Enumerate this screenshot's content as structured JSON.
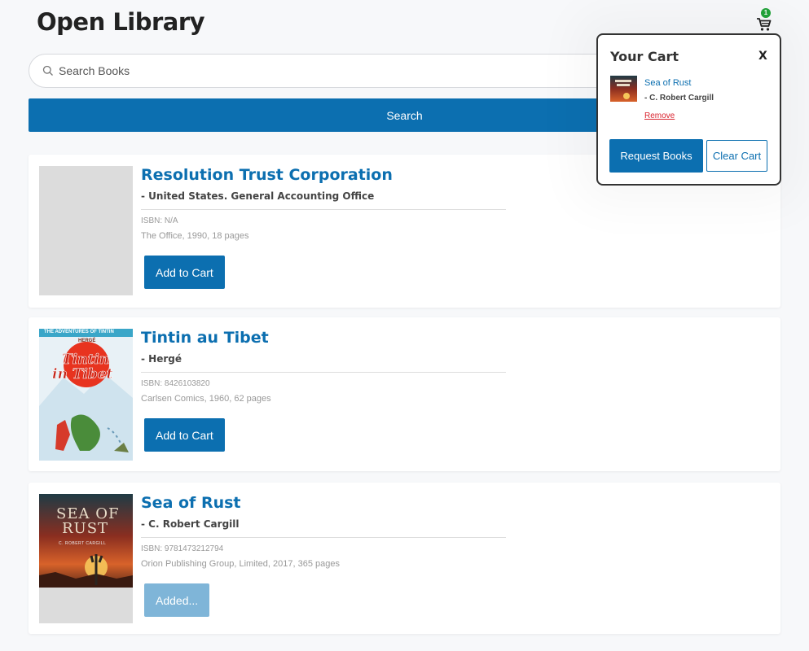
{
  "app": {
    "title": "Open Library"
  },
  "cart_badge": {
    "count": "1",
    "color": "#22a33a"
  },
  "search": {
    "placeholder": "Search Books",
    "button_label": "Search"
  },
  "colors": {
    "accent": "#0c6fb0",
    "remove": "#d9232e",
    "added_button": "#7fb5d8"
  },
  "books": [
    {
      "title": "Resolution Trust Corporation",
      "author": "- United States. General Accounting Office",
      "isbn": "ISBN: N/A",
      "publisher_line": "The Office, 1990, 18 pages",
      "button_label": "Add to Cart",
      "cover": "placeholder"
    },
    {
      "title": "Tintin au Tibet",
      "author": "- Hergé",
      "isbn": "ISBN: 8426103820",
      "publisher_line": "Carlsen Comics, 1960, 62 pages",
      "button_label": "Add to Cart",
      "cover": "tintin-cover",
      "cover_text": {
        "series": "THE ADVENTURES OF TINTIN",
        "title_1": "Tintin",
        "title_2": "in Tibet",
        "author": "HERGÉ"
      }
    },
    {
      "title": "Sea of Rust",
      "author": "- C. Robert Cargill",
      "isbn": "ISBN: 9781473212794",
      "publisher_line": "Orion Publishing Group, Limited, 2017, 365 pages",
      "button_label": "Added...",
      "cover": "sea-of-rust-cover",
      "cover_text": {
        "title_1": "SEA OF",
        "title_2": "RUST",
        "author": "C. ROBERT CARGILL"
      }
    }
  ],
  "cart_panel": {
    "title": "Your Cart",
    "close_label": "X",
    "item": {
      "title": "Sea of Rust",
      "author": "- C. Robert Cargill",
      "remove_label": "Remove"
    },
    "request_label": "Request Books",
    "clear_label": "Clear Cart"
  }
}
